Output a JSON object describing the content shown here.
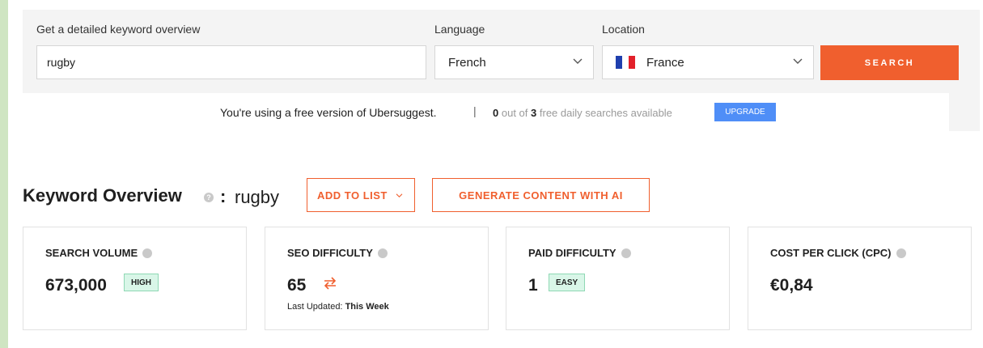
{
  "search": {
    "keyword_label": "Get a detailed keyword overview",
    "keyword_value": "rugby",
    "language_label": "Language",
    "language_value": "French",
    "location_label": "Location",
    "location_value": "France",
    "search_button": "SEARCH"
  },
  "notice": {
    "message": "You're using a free version of Ubersuggest.",
    "separator": "|",
    "used": "0",
    "out_of_text": "out of",
    "total": "3",
    "tail_text": "free daily searches available",
    "upgrade_button": "UPGRADE"
  },
  "overview": {
    "title": "Keyword Overview",
    "colon": ":",
    "keyword": "rugby",
    "add_to_list": "ADD TO LIST",
    "generate_ai": "GENERATE CONTENT WITH AI"
  },
  "cards": [
    {
      "title": "SEARCH VOLUME",
      "value": "673,000",
      "badge": "HIGH"
    },
    {
      "title": "SEO DIFFICULTY",
      "value": "65",
      "updated_label": "Last Updated:",
      "updated_value": "This Week"
    },
    {
      "title": "PAID DIFFICULTY",
      "value": "1",
      "badge": "EASY"
    },
    {
      "title": "COST PER CLICK (CPC)",
      "value": "€0,84"
    }
  ],
  "colors": {
    "accent": "#f05f2e",
    "upgrade": "#4f8ef7",
    "badge_bg": "#d9f6e8",
    "frame_bg": "#cfe5c2"
  },
  "icons": [
    "chevron-down-icon",
    "france-flag-icon",
    "info-icon",
    "swap-arrows-icon"
  ]
}
